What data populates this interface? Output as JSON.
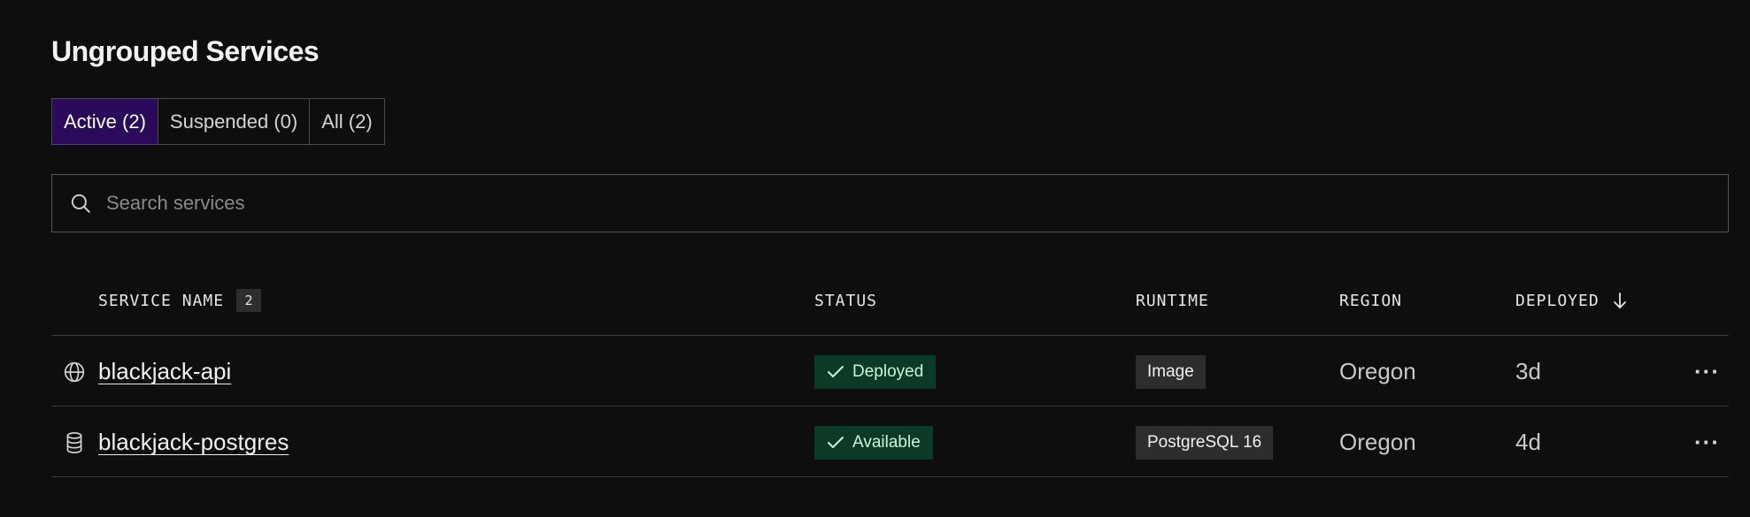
{
  "section": {
    "title": "Ungrouped Services"
  },
  "tabs": [
    {
      "label": "Active (2)",
      "active": true
    },
    {
      "label": "Suspended (0)",
      "active": false
    },
    {
      "label": "All (2)",
      "active": false
    }
  ],
  "search": {
    "placeholder": "Search services",
    "value": "",
    "icon": "search-icon"
  },
  "table": {
    "columns": {
      "name": "SERVICE NAME",
      "name_count": "2",
      "status": "STATUS",
      "runtime": "RUNTIME",
      "region": "REGION",
      "deployed": "DEPLOYED",
      "deployed_sort_icon": "arrow-down-icon"
    },
    "rows": [
      {
        "icon": "globe-icon",
        "name": "blackjack-api",
        "status": "Deployed",
        "runtime": "Image",
        "region": "Oregon",
        "deployed": "3d",
        "more": "···"
      },
      {
        "icon": "database-icon",
        "name": "blackjack-postgres",
        "status": "Available",
        "runtime": "PostgreSQL 16",
        "region": "Oregon",
        "deployed": "4d",
        "more": "···"
      }
    ]
  },
  "colors": {
    "background": "#0e0e0e",
    "active_tab": "#2a0a5a",
    "status_badge_bg": "#0b3b26",
    "status_badge_text": "#c9f2da",
    "runtime_badge_bg": "#2d2d2d"
  }
}
